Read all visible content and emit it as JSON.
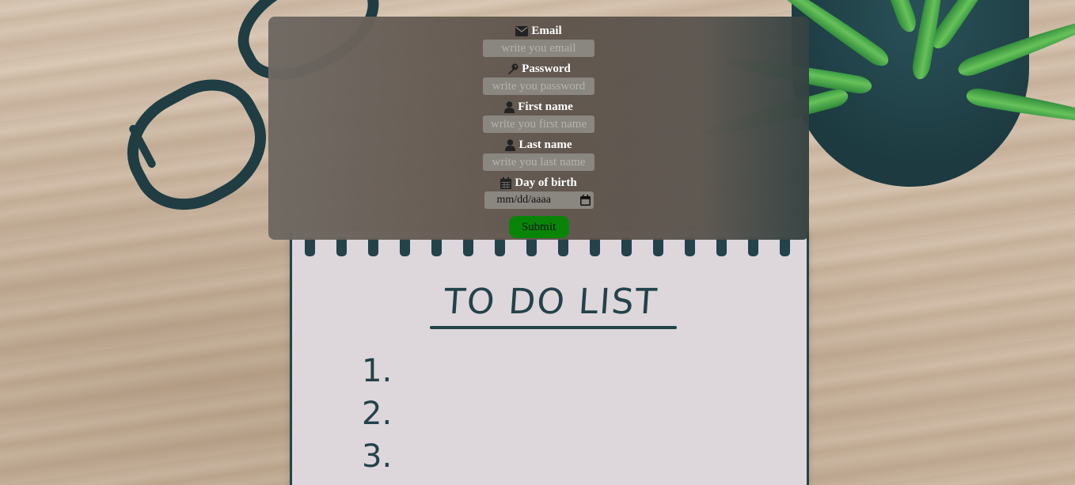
{
  "form": {
    "email": {
      "label": "Email",
      "placeholder": "write you email",
      "icon": "envelope-icon"
    },
    "password": {
      "label": "Password",
      "placeholder": "write you password",
      "icon": "key-icon"
    },
    "first_name": {
      "label": "First name",
      "placeholder": "write you first name",
      "icon": "user-icon"
    },
    "last_name": {
      "label": "Last name",
      "placeholder": "write you last name",
      "icon": "user-icon"
    },
    "birth": {
      "label": "Day of birth",
      "placeholder": "mm/dd/aaaa",
      "icon": "calendar-icon"
    },
    "submit_label": "Submit"
  },
  "background": {
    "notebook_title": "TO DO LIST",
    "notebook_items": [
      "1.",
      "2.",
      "3."
    ]
  },
  "colors": {
    "panel": "#6b625b",
    "submit": "#088508",
    "ink": "#23424a"
  }
}
